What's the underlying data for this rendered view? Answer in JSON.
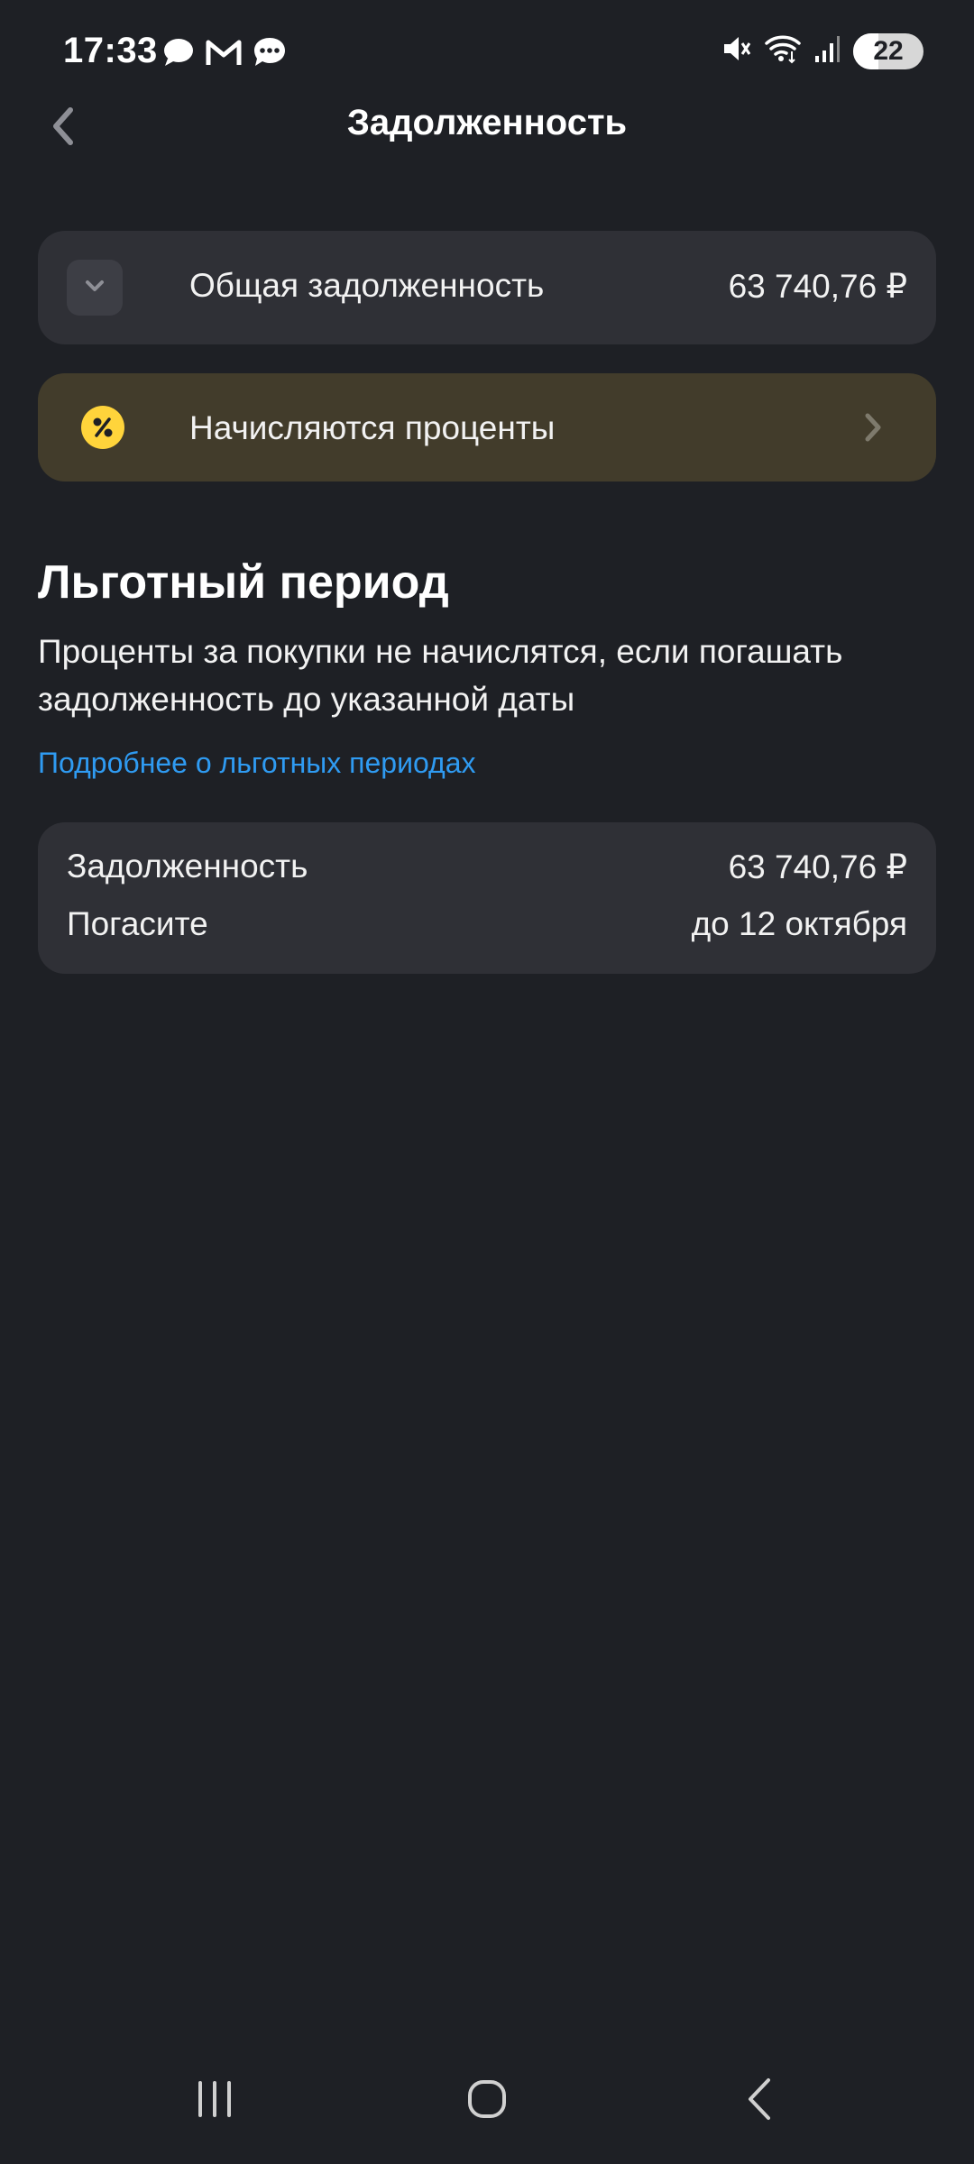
{
  "status_bar": {
    "time": "17:33",
    "battery_level": "22",
    "left_icons": [
      "chat-bubble-icon",
      "gmail-icon",
      "message-icon"
    ],
    "right_icons": [
      "mute-icon",
      "wifi-icon",
      "signal-icon",
      "battery-icon"
    ]
  },
  "header": {
    "title": "Задолженность"
  },
  "total_card": {
    "label": "Общая задолженность",
    "value": "63 740,76 ₽"
  },
  "interest_card": {
    "label": "Начисляются проценты",
    "color": "#423c2b",
    "icon_color": "#ffd43b"
  },
  "grace_section": {
    "title": "Льготный период",
    "description": "Проценты за покупки не начислятся, если погашать задолженность до указанной даты",
    "link": "Подробнее о льготных периодах",
    "link_color": "#2f9bf2"
  },
  "grace_card": {
    "rows": [
      {
        "label": "Задолженность",
        "value": "63 740,76 ₽"
      },
      {
        "label": "Погасите",
        "value": "до 12 октября"
      }
    ]
  },
  "nav_bar": {
    "buttons": [
      "recents-icon",
      "home-icon",
      "back-icon"
    ]
  }
}
